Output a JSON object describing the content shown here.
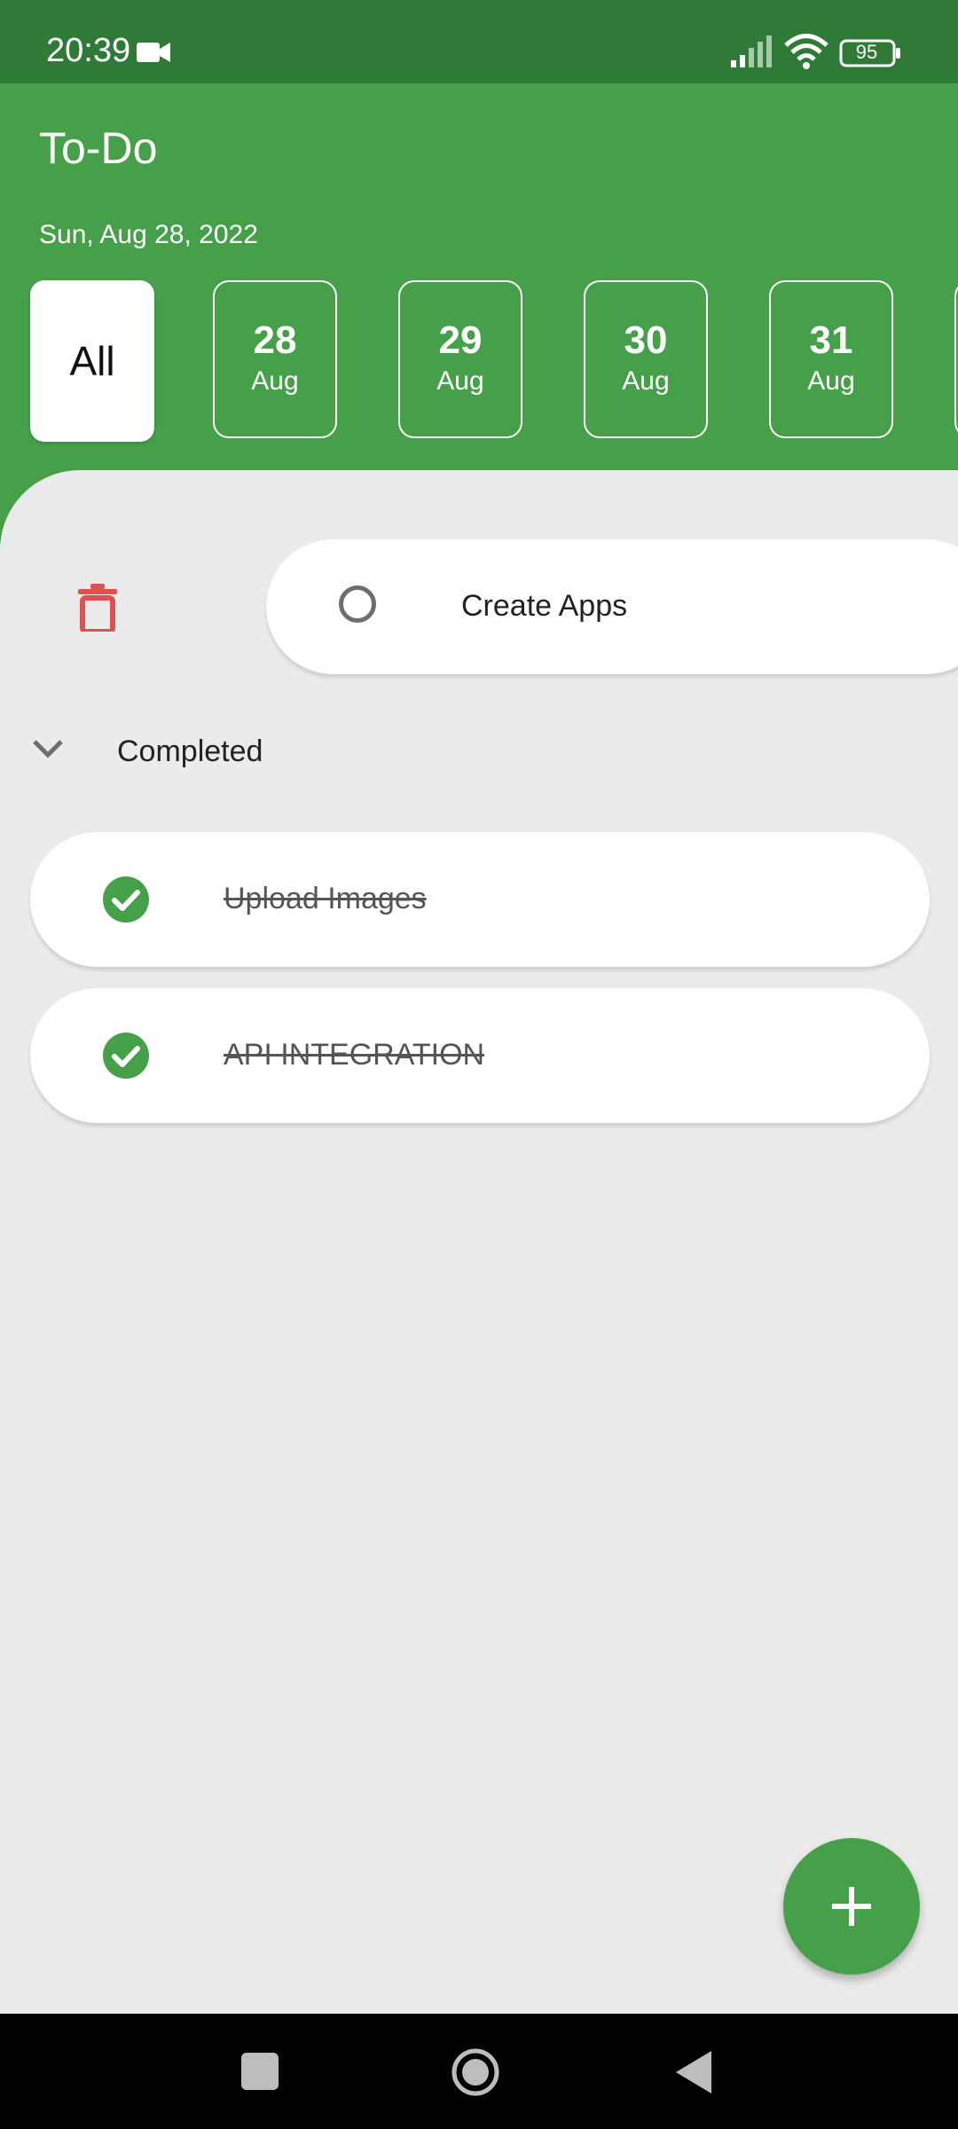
{
  "status_bar": {
    "time": "20:39",
    "battery": "95",
    "icons": [
      "video-camera-icon",
      "signal-icon",
      "wifi-icon",
      "battery-icon"
    ]
  },
  "header": {
    "title": "To-Do",
    "date": "Sun, Aug 28, 2022",
    "filters": {
      "all_label": "All",
      "dates": [
        {
          "day": "28",
          "month": "Aug"
        },
        {
          "day": "29",
          "month": "Aug"
        },
        {
          "day": "30",
          "month": "Aug"
        },
        {
          "day": "31",
          "month": "Aug"
        }
      ]
    }
  },
  "tasks": {
    "pending": [
      {
        "label": "Create Apps"
      }
    ],
    "completed_section_label": "Completed",
    "completed": [
      {
        "label": "Upload Images"
      },
      {
        "label": "API INTEGRATION "
      }
    ]
  },
  "colors": {
    "primary": "#45a049",
    "status_bar": "#2f7a37",
    "delete": "#e05050",
    "background": "#ebebeb"
  }
}
